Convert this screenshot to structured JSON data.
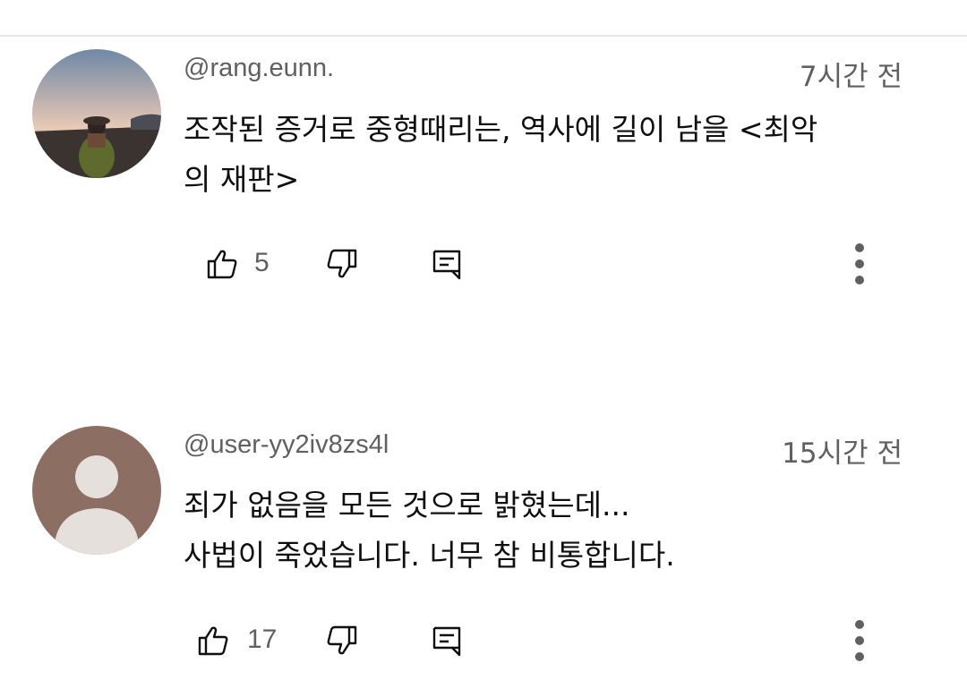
{
  "comments": [
    {
      "username": "@rang.eunn.",
      "time": "7시간 전",
      "lines": [
        "조작된 증거로 중형때리는, 역사에 길이 남을 <최악",
        "의 재판>"
      ],
      "likes": "5",
      "avatar": "photo-avatar"
    },
    {
      "username": "@user-yy2iv8zs4l",
      "time": "15시간 전",
      "lines": [
        "죄가 없음을 모든 것으로 밝혔는데...",
        "사법이 죽었습니다. 너무 참 비통합니다."
      ],
      "likes": "17",
      "avatar": "default-avatar"
    }
  ],
  "icons": {
    "like": "thumbs-up-icon",
    "dislike": "thumbs-down-icon",
    "reply": "reply-icon",
    "more": "more-vertical-icon"
  },
  "colors": {
    "secondary_text": "#606060",
    "primary_text": "#0f0f0f",
    "divider": "#e5e5e5",
    "default_avatar_bg": "#8d6e63",
    "default_avatar_fg": "#e6e0dc"
  }
}
